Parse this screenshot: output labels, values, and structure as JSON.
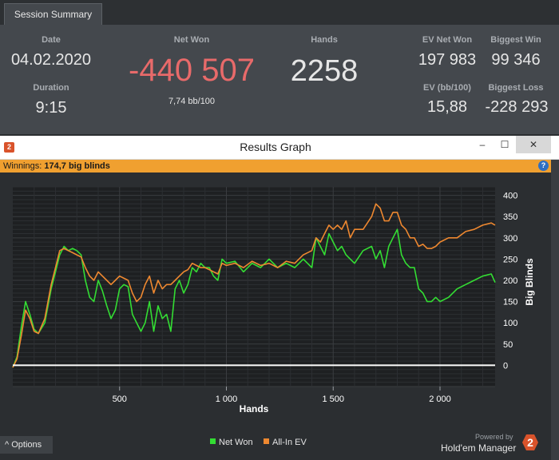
{
  "summary": {
    "tab": "Session Summary",
    "date_label": "Date",
    "date": "04.02.2020",
    "duration_label": "Duration",
    "duration": "9:15",
    "netwon_label": "Net Won",
    "netwon": "-440 507",
    "bb100": "7,74 bb/100",
    "hands_label": "Hands",
    "hands": "2258",
    "ev_label": "EV Net Won",
    "ev": "197 983",
    "evbb_label": "EV (bb/100)",
    "evbb": "15,88",
    "bigwin_label": "Biggest Win",
    "bigwin": "99 346",
    "bigloss_label": "Biggest Loss",
    "bigloss": "-228 293",
    "colors": {
      "negative": "#e86a6a",
      "text": "#e6e6e6",
      "label": "#a9adb2"
    }
  },
  "window": {
    "title": "Results Graph",
    "app_icon": "2",
    "minimize": "‒",
    "maximize": "☐",
    "close": "✕",
    "help_icon": "?",
    "winnings_label": "Winnings:",
    "winnings_value": "174,7 big blinds"
  },
  "footer": {
    "options": "^  Options",
    "powered": "Powered by",
    "brand": "Hold'em Manager",
    "brand_logo": "2",
    "legend": [
      {
        "name": "Net Won",
        "color": "#33dd33"
      },
      {
        "name": "All-In EV",
        "color": "#ee8830"
      }
    ]
  },
  "chart_data": {
    "type": "line",
    "xlabel": "Hands",
    "ylabel": "Big Blinds",
    "xlim": [
      0,
      2258
    ],
    "ylim": [
      -50,
      420
    ],
    "xticks": [
      500,
      1000,
      1500,
      2000
    ],
    "xtick_labels": [
      "500",
      "1 000",
      "1 500",
      "2 000"
    ],
    "yticks": [
      0,
      50,
      100,
      150,
      200,
      250,
      300,
      350,
      400
    ],
    "grid": true,
    "legend_position": "bottom",
    "zero_line_color": "#ffffff",
    "series": [
      {
        "name": "Net Won",
        "color": "#33dd33",
        "x": [
          0,
          20,
          40,
          60,
          80,
          100,
          120,
          150,
          180,
          200,
          220,
          240,
          260,
          280,
          300,
          320,
          340,
          360,
          380,
          400,
          420,
          440,
          460,
          480,
          500,
          520,
          540,
          560,
          580,
          600,
          620,
          640,
          660,
          680,
          700,
          720,
          740,
          760,
          780,
          800,
          820,
          840,
          860,
          880,
          900,
          920,
          940,
          960,
          980,
          1000,
          1040,
          1080,
          1120,
          1160,
          1200,
          1240,
          1280,
          1320,
          1360,
          1400,
          1420,
          1440,
          1460,
          1480,
          1500,
          1520,
          1540,
          1560,
          1580,
          1600,
          1640,
          1680,
          1700,
          1720,
          1740,
          1760,
          1780,
          1800,
          1820,
          1840,
          1860,
          1880,
          1900,
          1920,
          1940,
          1960,
          1980,
          2000,
          2040,
          2080,
          2120,
          2160,
          2200,
          2240,
          2258
        ],
        "y": [
          -5,
          20,
          90,
          150,
          120,
          85,
          75,
          100,
          180,
          220,
          260,
          280,
          270,
          275,
          270,
          260,
          200,
          160,
          150,
          200,
          175,
          140,
          110,
          130,
          180,
          190,
          185,
          120,
          100,
          80,
          100,
          150,
          80,
          140,
          110,
          120,
          80,
          180,
          200,
          170,
          190,
          230,
          220,
          240,
          230,
          230,
          210,
          200,
          250,
          240,
          245,
          220,
          240,
          230,
          250,
          230,
          240,
          230,
          250,
          230,
          300,
          280,
          260,
          310,
          290,
          270,
          280,
          260,
          250,
          240,
          270,
          280,
          250,
          270,
          230,
          280,
          300,
          320,
          260,
          240,
          230,
          230,
          180,
          170,
          150,
          150,
          160,
          150,
          160,
          180,
          190,
          200,
          210,
          215,
          195
        ]
      },
      {
        "name": "All-In EV",
        "color": "#ee8830",
        "x": [
          0,
          20,
          40,
          60,
          80,
          100,
          120,
          150,
          180,
          200,
          220,
          240,
          260,
          280,
          300,
          320,
          340,
          360,
          380,
          400,
          420,
          440,
          460,
          480,
          500,
          520,
          540,
          560,
          580,
          600,
          620,
          640,
          660,
          680,
          700,
          720,
          740,
          760,
          780,
          800,
          820,
          840,
          860,
          880,
          900,
          920,
          940,
          960,
          980,
          1000,
          1040,
          1080,
          1120,
          1160,
          1200,
          1240,
          1280,
          1320,
          1360,
          1400,
          1420,
          1440,
          1460,
          1480,
          1500,
          1520,
          1540,
          1560,
          1580,
          1600,
          1640,
          1680,
          1700,
          1720,
          1740,
          1760,
          1780,
          1800,
          1820,
          1840,
          1860,
          1880,
          1900,
          1920,
          1940,
          1960,
          1980,
          2000,
          2040,
          2080,
          2120,
          2160,
          2200,
          2240,
          2258
        ],
        "y": [
          -5,
          15,
          70,
          130,
          110,
          80,
          75,
          110,
          190,
          230,
          270,
          275,
          270,
          265,
          260,
          255,
          230,
          210,
          200,
          220,
          210,
          200,
          190,
          200,
          210,
          205,
          200,
          170,
          150,
          160,
          190,
          210,
          170,
          200,
          180,
          190,
          190,
          200,
          210,
          220,
          225,
          240,
          235,
          230,
          230,
          225,
          220,
          215,
          240,
          235,
          240,
          230,
          245,
          235,
          240,
          230,
          245,
          240,
          260,
          270,
          300,
          290,
          310,
          330,
          320,
          330,
          320,
          340,
          300,
          320,
          320,
          350,
          380,
          370,
          340,
          340,
          360,
          360,
          330,
          320,
          300,
          300,
          280,
          285,
          275,
          275,
          280,
          290,
          300,
          300,
          315,
          320,
          330,
          335,
          330
        ]
      }
    ]
  }
}
